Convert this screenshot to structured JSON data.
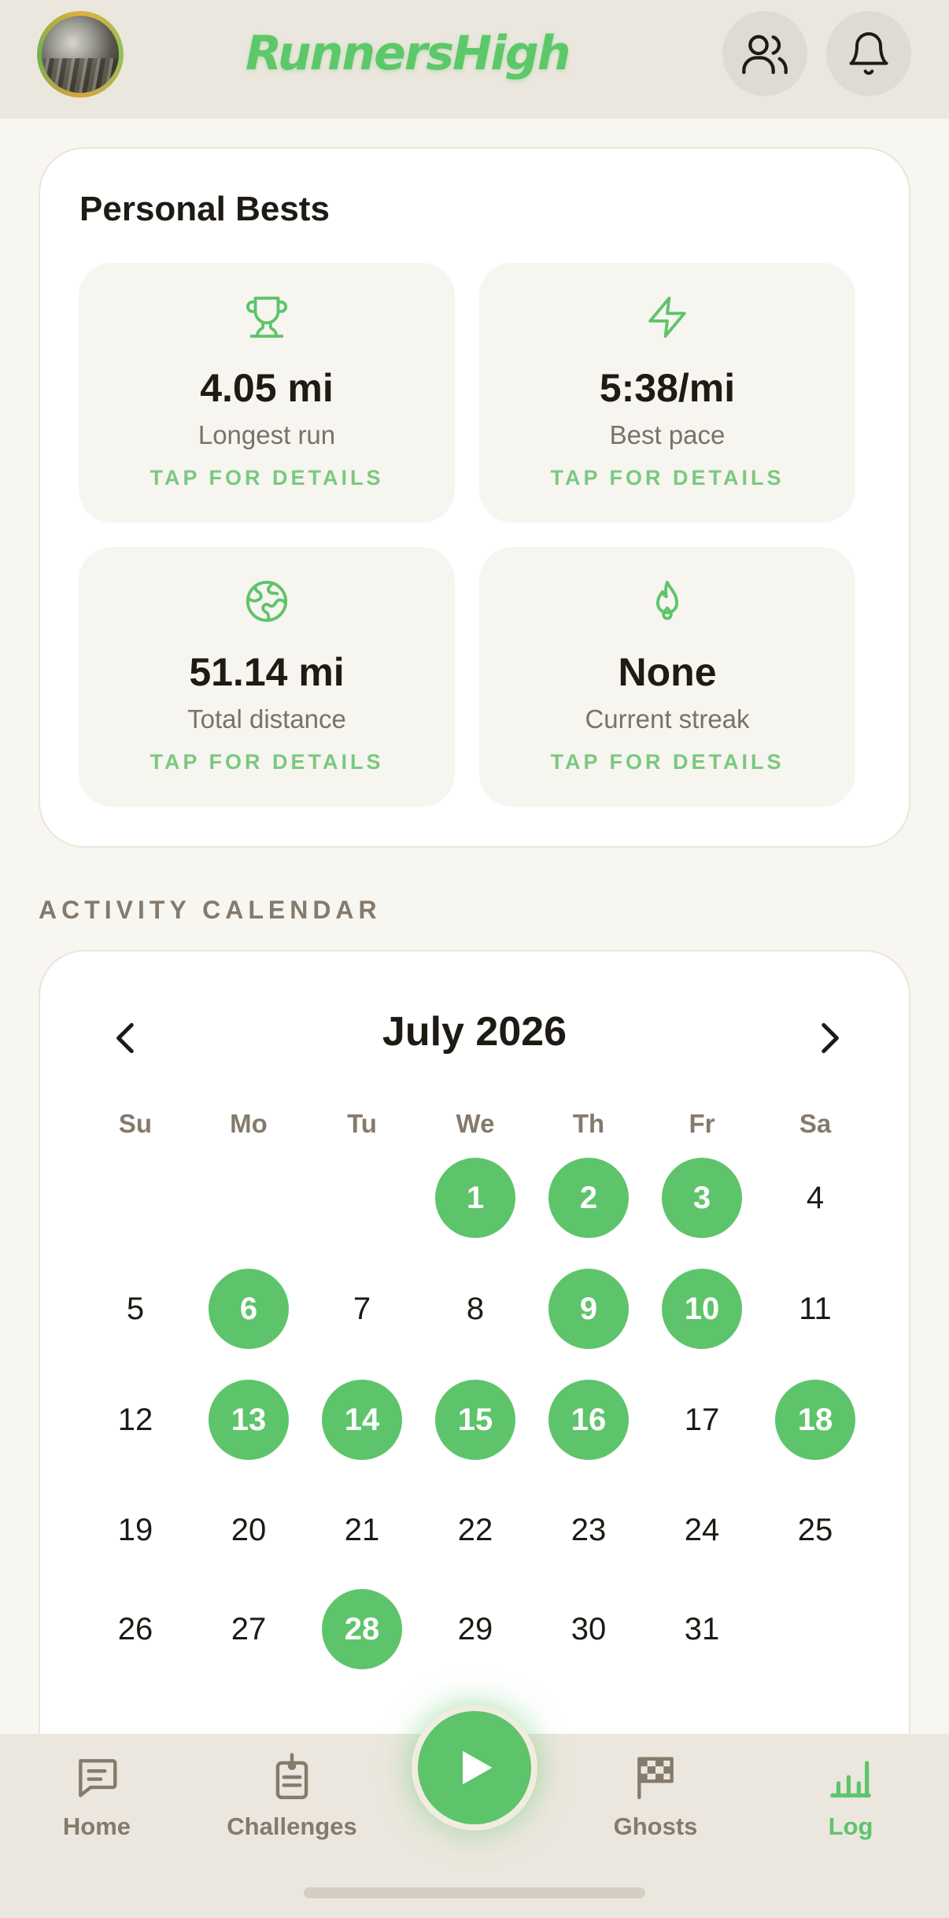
{
  "header": {
    "brand": "RunnersHigh",
    "icons": {
      "friends": "friends-icon",
      "notifications": "bell-icon"
    }
  },
  "personal_bests": {
    "title": "Personal Bests",
    "stats": [
      {
        "icon": "trophy-icon",
        "value": "4.05 mi",
        "label": "Longest run",
        "cta": "TAP FOR DETAILS"
      },
      {
        "icon": "lightning-icon",
        "value": "5:38/mi",
        "label": "Best pace",
        "cta": "TAP FOR DETAILS"
      },
      {
        "icon": "globe-icon",
        "value": "51.14 mi",
        "label": "Total distance",
        "cta": "TAP FOR DETAILS"
      },
      {
        "icon": "flame-icon",
        "value": "None",
        "label": "Current streak",
        "cta": "TAP FOR DETAILS"
      }
    ]
  },
  "activity_calendar": {
    "section_label": "ACTIVITY CALENDAR",
    "month_title": "July 2026",
    "weekdays": [
      "Su",
      "Mo",
      "Tu",
      "We",
      "Th",
      "Fr",
      "Sa"
    ],
    "first_weekday_index": 3,
    "days_in_month": 31,
    "active_days": [
      1,
      2,
      3,
      6,
      9,
      10,
      13,
      14,
      15,
      16,
      18,
      28
    ]
  },
  "bottom_nav": {
    "items": [
      {
        "label": "Home",
        "icon": "chat-icon"
      },
      {
        "label": "Challenges",
        "icon": "clipboard-icon"
      },
      {
        "label": "Ghosts",
        "icon": "checkered-flag-icon"
      },
      {
        "label": "Log",
        "icon": "bar-chart-icon"
      }
    ],
    "active": "Log",
    "play_icon": "play-icon"
  },
  "colors": {
    "accent": "#5ec46b",
    "header_bg": "#ece7de",
    "page_bg": "#f7f6f1",
    "muted_text": "#857a6b"
  }
}
